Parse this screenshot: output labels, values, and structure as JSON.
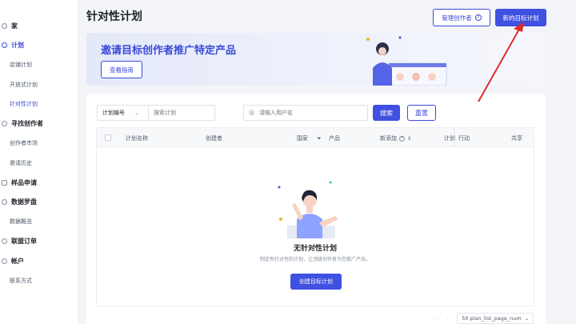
{
  "sidebar": {
    "items": [
      {
        "label": "家",
        "type": "group",
        "icon": "home-icon"
      },
      {
        "label": "计划",
        "type": "group",
        "icon": "plan-icon",
        "active": true
      },
      {
        "label": "店铺计划",
        "type": "sub"
      },
      {
        "label": "开放式计划",
        "type": "sub"
      },
      {
        "label": "针对性计划",
        "type": "sub",
        "active": true
      },
      {
        "label": "寻找创作者",
        "type": "group",
        "icon": "search-creator-icon"
      },
      {
        "label": "创作者市场",
        "type": "sub"
      },
      {
        "label": "邀请历史",
        "type": "sub"
      },
      {
        "label": "样品申请",
        "type": "group",
        "icon": "sample-icon"
      },
      {
        "label": "数据罗盘",
        "type": "group",
        "icon": "compass-icon"
      },
      {
        "label": "数据概览",
        "type": "sub"
      },
      {
        "label": "联盟订单",
        "type": "group",
        "icon": "order-icon"
      },
      {
        "label": "帐户",
        "type": "group",
        "icon": "account-icon"
      },
      {
        "label": "联系方式",
        "type": "sub"
      }
    ]
  },
  "header": {
    "title": "针对性计划",
    "manage_creators_label": "管理创作者",
    "new_plan_label": "新的目标计划"
  },
  "banner": {
    "title": "邀请目标创作者推广特定产品",
    "guide_label": "查看指南"
  },
  "filters": {
    "plan_select_label": "计划编号",
    "search_plan_placeholder": "搜索计划",
    "username_placeholder": "请输入用户名",
    "at_symbol": "@",
    "search_label": "搜索",
    "reset_label": "重置"
  },
  "table": {
    "columns": {
      "name": "计划名称",
      "creator": "创建者",
      "country": "国家",
      "product": "产品",
      "new_creator": "新添加",
      "plan": "计划",
      "action": "行动",
      "share": "共享"
    }
  },
  "empty_state": {
    "title": "无针对性计划",
    "description": "制定有针对性的计划，让顶级创作者为您推广产品。",
    "create_label": "创建目标计划"
  },
  "pagination": {
    "page_size_label": "50 plan_list_page_num"
  },
  "colors": {
    "primary": "#4050e0",
    "annotation_arrow": "#e02b2b",
    "banner_bg": "#e8ecfa"
  }
}
